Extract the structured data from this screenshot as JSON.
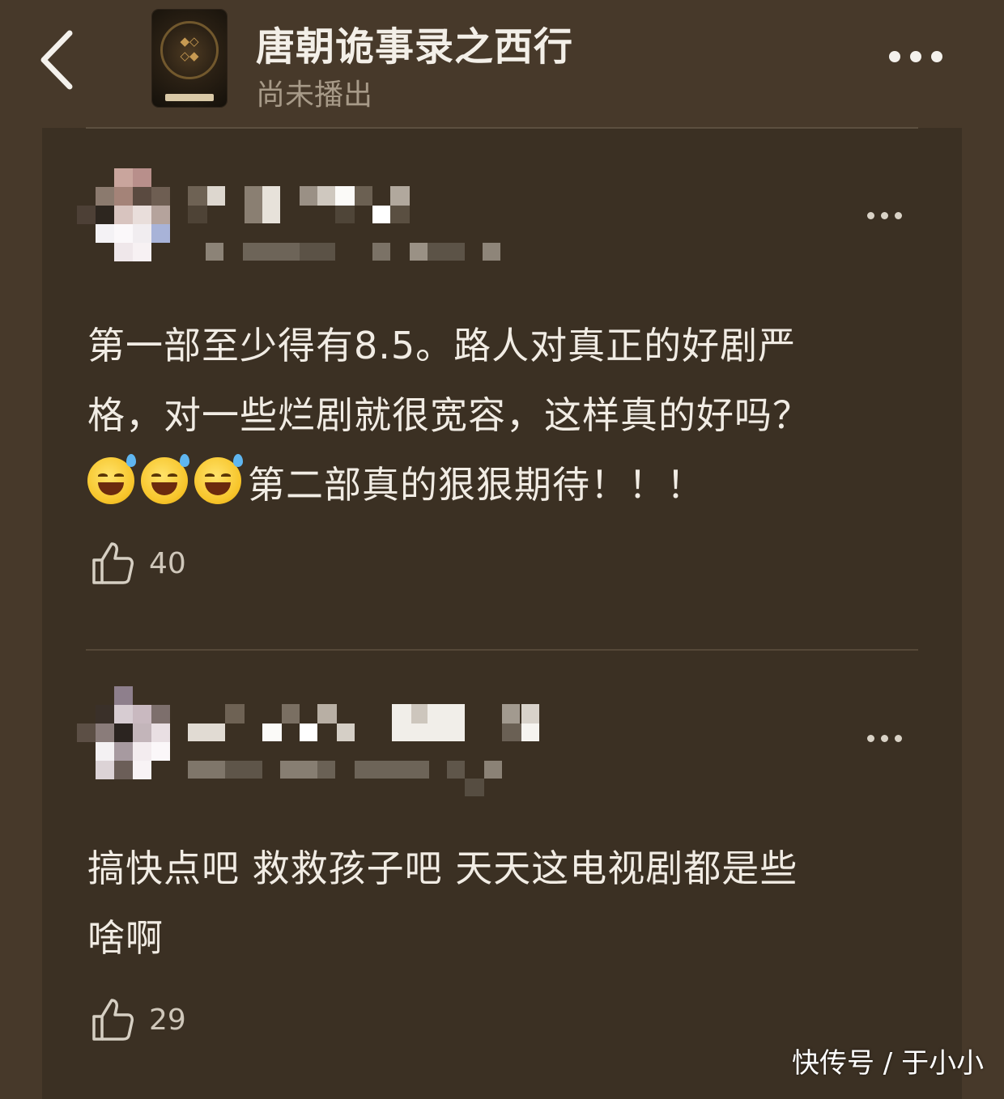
{
  "header": {
    "title": "唐朝诡事录之西行",
    "status": "尚未播出",
    "back_icon": "chevron-left-icon",
    "more_icon": "more-horizontal-icon"
  },
  "comments": [
    {
      "username": "",
      "text_line1": "第一部至少得有8.5。路人对真正的好剧严",
      "text_line2": "格，对一些烂剧就很宽容，这样真的好吗？",
      "text_line3": "第二部真的狠狠期待！！！",
      "emoji_names": [
        "grinning-sweat-emoji",
        "grinning-sweat-emoji",
        "grinning-sweat-emoji"
      ],
      "likes": "40"
    },
    {
      "username": "",
      "text_line1": "搞快点吧 救救孩子吧 天天这电视剧都是些",
      "text_line2": "啥啊",
      "likes": "29"
    }
  ],
  "watermark": "快传号 / 于小小",
  "colors": {
    "background": "#47392a",
    "panel": "#3b3023",
    "text": "#f1ece4",
    "muted": "#a79a88"
  }
}
